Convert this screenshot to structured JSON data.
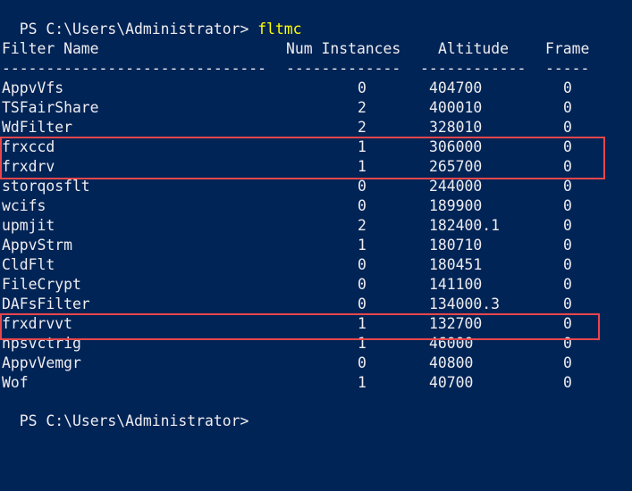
{
  "prompt": {
    "text": "PS C:\\Users\\Administrator> ",
    "command": "fltmc"
  },
  "headers": [
    "Filter Name",
    "Num Instances",
    "Altitude",
    "Frame"
  ],
  "separators": [
    "------------------------------",
    "-------------",
    "------------",
    "-----"
  ],
  "rows": [
    {
      "name": "AppvVfs",
      "instances": "0",
      "altitude": "404700",
      "frame": "0"
    },
    {
      "name": "TSFairShare",
      "instances": "2",
      "altitude": "400010",
      "frame": "0"
    },
    {
      "name": "WdFilter",
      "instances": "2",
      "altitude": "328010",
      "frame": "0"
    },
    {
      "name": "frxccd",
      "instances": "1",
      "altitude": "306000",
      "frame": "0"
    },
    {
      "name": "frxdrv",
      "instances": "1",
      "altitude": "265700",
      "frame": "0"
    },
    {
      "name": "storqosflt",
      "instances": "0",
      "altitude": "244000",
      "frame": "0"
    },
    {
      "name": "wcifs",
      "instances": "0",
      "altitude": "189900",
      "frame": "0"
    },
    {
      "name": "upmjit",
      "instances": "2",
      "altitude": "182400.1",
      "frame": "0"
    },
    {
      "name": "AppvStrm",
      "instances": "1",
      "altitude": "180710",
      "frame": "0"
    },
    {
      "name": "CldFlt",
      "instances": "0",
      "altitude": "180451",
      "frame": "0"
    },
    {
      "name": "FileCrypt",
      "instances": "0",
      "altitude": "141100",
      "frame": "0"
    },
    {
      "name": "DAFsFilter",
      "instances": "0",
      "altitude": "134000.3",
      "frame": "0"
    },
    {
      "name": "frxdrvvt",
      "instances": "1",
      "altitude": "132700",
      "frame": "0"
    },
    {
      "name": "npsvctrig",
      "instances": "1",
      "altitude": "46000",
      "frame": "0"
    },
    {
      "name": "AppvVemgr",
      "instances": "0",
      "altitude": "40800",
      "frame": "0"
    },
    {
      "name": "Wof",
      "instances": "1",
      "altitude": "40700",
      "frame": "0"
    }
  ],
  "next_prompt": "PS C:\\Users\\Administrator>",
  "colors": {
    "background": "#012456",
    "text": "#eeedf0",
    "command": "#ffff00",
    "highlight_border": "#e8474b"
  }
}
